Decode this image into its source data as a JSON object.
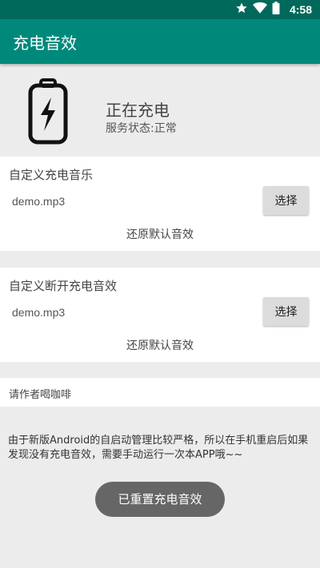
{
  "status_bar": {
    "time": "4:58",
    "icons": [
      "star-icon",
      "wifi-icon",
      "battery-status-icon"
    ]
  },
  "app_bar": {
    "title": "充电音效"
  },
  "charge_status": {
    "title": "正在充电",
    "service": "服务状态:正常",
    "icon": "battery-charging-icon"
  },
  "section_connect": {
    "title": "自定义充电音乐",
    "file": "demo.mp3",
    "pick_label": "选择",
    "restore_label": "还原默认音效"
  },
  "section_disconnect": {
    "title": "自定义断开充电音效",
    "file": "demo.mp3",
    "pick_label": "选择",
    "restore_label": "还原默认音效"
  },
  "coffee": {
    "label": "请作者喝咖啡"
  },
  "note": {
    "text": "由于新版Android的自启动管理比较严格，所以在手机重启后如果发现没有充电音效，需要手动运行一次本APP哦~~"
  },
  "toast": {
    "text": "已重置充电音效"
  },
  "colors": {
    "status_bar": "#00695c",
    "app_bar": "#00897b",
    "background": "#ececec",
    "toast": "#666666"
  }
}
